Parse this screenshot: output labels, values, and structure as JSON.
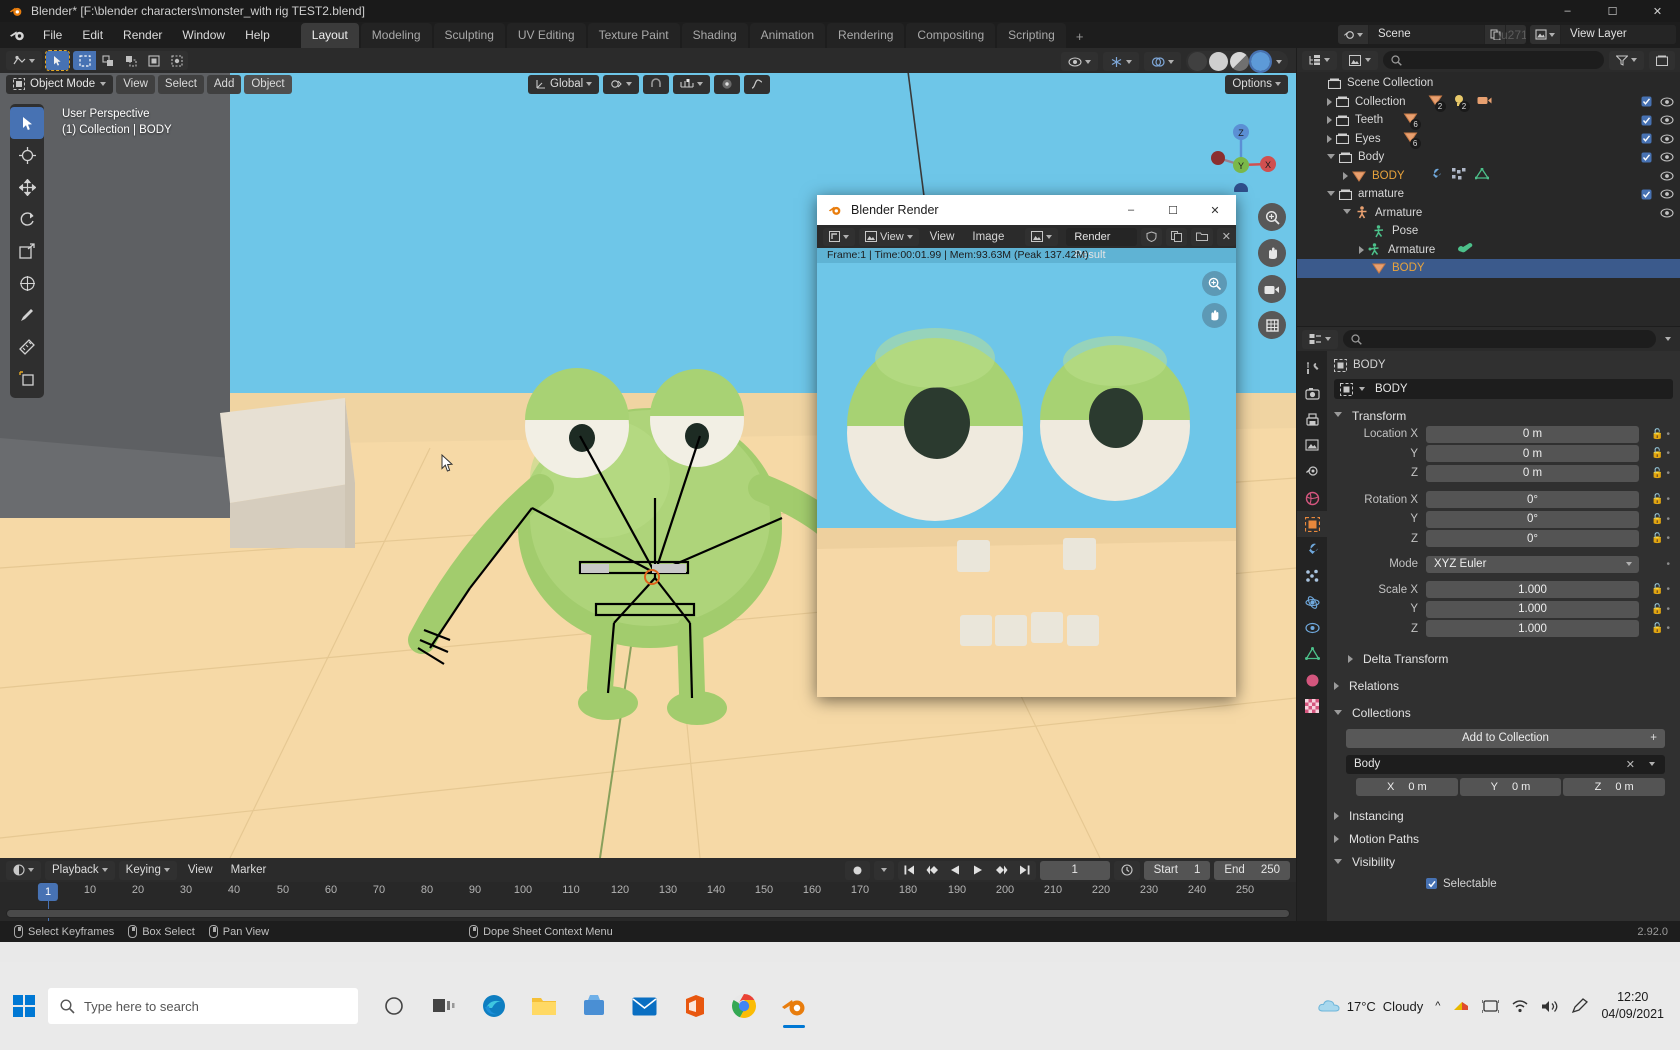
{
  "window": {
    "title": "Blender* [F:\\blender characters\\monster_with rig TEST2.blend]",
    "minimize": "–",
    "maximize": "☐",
    "close": "✕"
  },
  "topbar": {
    "menus": [
      "File",
      "Edit",
      "Render",
      "Window",
      "Help"
    ],
    "workspaces": [
      "Layout",
      "Modeling",
      "Sculpting",
      "UV Editing",
      "Texture Paint",
      "Shading",
      "Animation",
      "Rendering",
      "Compositing",
      "Scripting"
    ],
    "active_workspace": "Layout",
    "add_workspace": "+",
    "scene_name": "Scene",
    "view_layer_name": "View Layer"
  },
  "viewport": {
    "mode": "Object Mode",
    "menus": [
      "View",
      "Select",
      "Add",
      "Object"
    ],
    "active_menu": "Object",
    "transform_orientation": "Global",
    "options_label": "Options",
    "overlay_line1": "User Perspective",
    "overlay_line2": "(1) Collection | BODY",
    "gizmo_axes": [
      "X",
      "Y",
      "Z"
    ],
    "background_sky": "#6ec6e8",
    "background_floor": "#f6d9a6"
  },
  "render_window": {
    "title": "Blender Render",
    "menus": [
      "View",
      "Image"
    ],
    "view_dropdown": "View",
    "image_name": "Render Result",
    "stats": "Frame:1 | Time:00:01.99 | Mem:93.63M (Peak 137.42M)",
    "minimize": "–",
    "maximize": "☐",
    "close": "✕"
  },
  "outliner": {
    "search_placeholder": "",
    "rows": [
      {
        "label": "Scene Collection",
        "depth": 0,
        "icon": "collection-icon",
        "expand": "none",
        "selected": false,
        "counts": []
      },
      {
        "label": "Collection",
        "depth": 1,
        "icon": "collection-icon",
        "expand": "closed",
        "selected": false,
        "counts": [
          "2",
          "2",
          ""
        ]
      },
      {
        "label": "Teeth",
        "depth": 1,
        "icon": "collection-icon",
        "expand": "closed",
        "selected": false,
        "counts": [
          "6"
        ]
      },
      {
        "label": "Eyes",
        "depth": 1,
        "icon": "collection-icon",
        "expand": "closed",
        "selected": false,
        "counts": [
          "6"
        ]
      },
      {
        "label": "Body",
        "depth": 1,
        "icon": "collection-icon",
        "expand": "open",
        "selected": false,
        "counts": []
      },
      {
        "label": "BODY",
        "depth": 2,
        "icon": "mesh-icon",
        "expand": "closed",
        "selected": false,
        "counts": []
      },
      {
        "label": "armature",
        "depth": 1,
        "icon": "collection-icon",
        "expand": "open",
        "selected": false,
        "counts": []
      },
      {
        "label": "Armature",
        "depth": 2,
        "icon": "armature-icon",
        "expand": "open",
        "selected": false,
        "counts": []
      },
      {
        "label": "Pose",
        "depth": 3,
        "icon": "pose-icon",
        "expand": "none",
        "selected": false,
        "counts": []
      },
      {
        "label": "Armature",
        "depth": 3,
        "icon": "armature-data-icon",
        "expand": "closed",
        "selected": false,
        "counts": []
      },
      {
        "label": "BODY",
        "depth": 3,
        "icon": "mesh-icon",
        "expand": "none",
        "selected": true,
        "counts": []
      }
    ]
  },
  "properties": {
    "breadcrumb_object": "BODY",
    "object_name": "BODY",
    "panels": {
      "transform": "Transform",
      "delta_transform": "Delta Transform",
      "relations": "Relations",
      "collections": "Collections",
      "instancing": "Instancing",
      "motion_paths": "Motion Paths",
      "visibility": "Visibility"
    },
    "transform_rows": [
      {
        "label": "Location X",
        "value": "0 m"
      },
      {
        "label": "Y",
        "value": "0 m"
      },
      {
        "label": "Z",
        "value": "0 m"
      },
      {
        "label": "Rotation X",
        "value": "0°"
      },
      {
        "label": "Y",
        "value": "0°"
      },
      {
        "label": "Z",
        "value": "0°"
      }
    ],
    "mode_label": "Mode",
    "mode_value": "XYZ Euler",
    "scale_rows": [
      {
        "label": "Scale X",
        "value": "1.000"
      },
      {
        "label": "Y",
        "value": "1.000"
      },
      {
        "label": "Z",
        "value": "1.000"
      }
    ],
    "add_to_collection": "Add to Collection",
    "collection_name": "Body",
    "collection_offset": [
      {
        "axis": "X",
        "value": "0 m"
      },
      {
        "axis": "Y",
        "value": "0 m"
      },
      {
        "axis": "Z",
        "value": "0 m"
      }
    ],
    "selectable_label": "Selectable",
    "selectable_checked": true
  },
  "timeline": {
    "menus": [
      "Playback",
      "Keying",
      "View",
      "Marker"
    ],
    "current_frame": "1",
    "start_label": "Start",
    "start_value": "1",
    "end_label": "End",
    "end_value": "250",
    "playhead_frame": "1",
    "ticks": [
      "10",
      "20",
      "30",
      "40",
      "50",
      "60",
      "70",
      "80",
      "90",
      "100",
      "110",
      "120",
      "130",
      "140",
      "150",
      "160",
      "170",
      "180",
      "190",
      "200",
      "210",
      "220",
      "230",
      "240",
      "250"
    ]
  },
  "statusbar": {
    "items": [
      {
        "mouse": "left",
        "label": "Select Keyframes"
      },
      {
        "mouse": "left-drag",
        "label": "Box Select"
      },
      {
        "mouse": "middle",
        "label": "Pan View"
      },
      {
        "mouse": "right",
        "label": "Dope Sheet Context Menu"
      }
    ],
    "version": "2.92.0"
  },
  "taskbar": {
    "search_placeholder": "Type here to search",
    "weather_temp": "17°C",
    "weather_desc": "Cloudy",
    "clock_time": "12:20",
    "clock_date": "04/09/2021"
  }
}
